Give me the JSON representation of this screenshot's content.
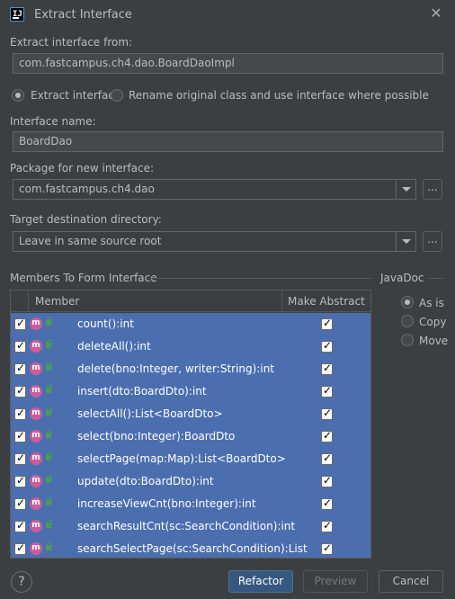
{
  "window": {
    "title": "Extract Interface",
    "app_icon": "intellij-icon",
    "close_icon": "close-icon"
  },
  "form": {
    "extract_from_label": "Extract interface from:",
    "extract_from_value": "com.fastcampus.ch4.dao.BoardDaoImpl",
    "mode_options": [
      {
        "label": "Extract interface",
        "selected": true
      },
      {
        "label": "Rename original class and use interface where possible",
        "selected": false
      }
    ],
    "interface_name_label": "Interface name:",
    "interface_name_value": "BoardDao",
    "package_label": "Package for new interface:",
    "package_value": "com.fastcampus.ch4.dao",
    "package_browse": "...",
    "target_dir_label": "Target destination directory:",
    "target_dir_value": "Leave in same source root",
    "target_dir_browse": "..."
  },
  "members": {
    "section_title": "Members To Form Interface",
    "columns": {
      "member": "Member",
      "make_abstract": "Make Abstract"
    },
    "items": [
      {
        "name": "count():int",
        "checked": true,
        "abstract": true
      },
      {
        "name": "deleteAll():int",
        "checked": true,
        "abstract": true
      },
      {
        "name": "delete(bno:Integer, writer:String):int",
        "checked": true,
        "abstract": true
      },
      {
        "name": "insert(dto:BoardDto):int",
        "checked": true,
        "abstract": true
      },
      {
        "name": "selectAll():List<BoardDto>",
        "checked": true,
        "abstract": true
      },
      {
        "name": "select(bno:Integer):BoardDto",
        "checked": true,
        "abstract": true
      },
      {
        "name": "selectPage(map:Map):List<BoardDto>",
        "checked": true,
        "abstract": true
      },
      {
        "name": "update(dto:BoardDto):int",
        "checked": true,
        "abstract": true
      },
      {
        "name": "increaseViewCnt(bno:Integer):int",
        "checked": true,
        "abstract": true
      },
      {
        "name": "searchResultCnt(sc:SearchCondition):int",
        "checked": true,
        "abstract": true
      },
      {
        "name": "searchSelectPage(sc:SearchCondition):List",
        "checked": true,
        "abstract": true
      }
    ],
    "method_badge": "m"
  },
  "javadoc": {
    "title": "JavaDoc",
    "options": [
      {
        "label": "As is",
        "selected": true
      },
      {
        "label": "Copy",
        "selected": false
      },
      {
        "label": "Move",
        "selected": false
      }
    ]
  },
  "footer": {
    "help": "?",
    "refactor": "Refactor",
    "preview": "Preview",
    "cancel": "Cancel"
  },
  "colors": {
    "background": "#3c3f41",
    "selection": "#4b6eaf",
    "primary_button": "#365880",
    "method_badge": "#c85f9b"
  }
}
